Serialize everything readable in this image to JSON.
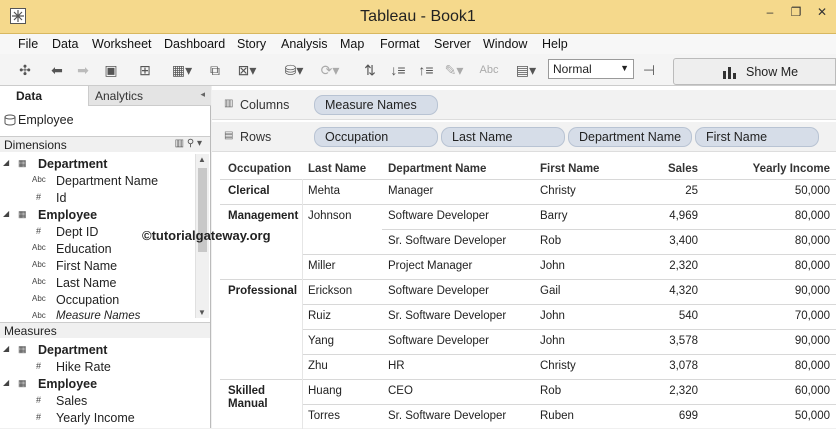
{
  "window": {
    "title": "Tableau - Book1",
    "min": "‒",
    "max": "❐",
    "close": "✕"
  },
  "menu": [
    "File",
    "Data",
    "Worksheet",
    "Dashboard",
    "Story",
    "Analysis",
    "Map",
    "Format",
    "Server",
    "Window",
    "Help"
  ],
  "toolbar": {
    "fit_value": "Normal",
    "show_me": "Show Me",
    "ghost_text": "Abc"
  },
  "left_pane": {
    "tab_data": "Data",
    "tab_analytics": "Analytics",
    "datasource": "Employee",
    "dimensions_label": "Dimensions",
    "measures_label": "Measures",
    "dimensions": [
      {
        "type": "table",
        "label": "Department"
      },
      {
        "type": "Abc",
        "label": "Department Name"
      },
      {
        "type": "#",
        "label": "Id"
      },
      {
        "type": "table",
        "label": "Employee"
      },
      {
        "type": "#",
        "label": "Dept ID"
      },
      {
        "type": "Abc",
        "label": "Education"
      },
      {
        "type": "Abc",
        "label": "First Name"
      },
      {
        "type": "Abc",
        "label": "Last Name"
      },
      {
        "type": "Abc",
        "label": "Occupation"
      },
      {
        "type": "Abc",
        "label": "Measure Names"
      }
    ],
    "measures": [
      {
        "type": "table",
        "label": "Department"
      },
      {
        "type": "#",
        "label": "Hike Rate"
      },
      {
        "type": "table",
        "label": "Employee"
      },
      {
        "type": "#",
        "label": "Sales"
      },
      {
        "type": "#",
        "label": "Yearly Income"
      }
    ]
  },
  "shelves": {
    "columns_label": "Columns",
    "rows_label": "Rows",
    "columns_pills": [
      "Measure Names"
    ],
    "rows_pills": [
      "Occupation",
      "Last Name",
      "Department Name",
      "First Name"
    ]
  },
  "watermark": "©tutorialgateway.org",
  "table": {
    "headers": [
      "Occupation",
      "Last Name",
      "Department Name",
      "First Name",
      "Sales",
      "Yearly Income"
    ],
    "rows": [
      [
        "Clerical",
        "Mehta",
        "Manager",
        "Christy",
        "25",
        "50,000"
      ],
      [
        "Management",
        "Johnson",
        "Software Developer",
        "Barry",
        "4,969",
        "80,000"
      ],
      [
        "",
        "",
        "Sr. Software Developer",
        "Rob",
        "3,400",
        "80,000"
      ],
      [
        "",
        "Miller",
        "Project Manager",
        "John",
        "2,320",
        "80,000"
      ],
      [
        "Professional",
        "Erickson",
        "Software Developer",
        "Gail",
        "4,320",
        "90,000"
      ],
      [
        "",
        "Ruiz",
        "Sr. Software Developer",
        "John",
        "540",
        "70,000"
      ],
      [
        "",
        "Yang",
        "Software Developer",
        "John",
        "3,578",
        "90,000"
      ],
      [
        "",
        "Zhu",
        "HR",
        "Christy",
        "3,078",
        "80,000"
      ],
      [
        "Skilled\nManual",
        "Huang",
        "CEO",
        "Rob",
        "2,320",
        "60,000"
      ],
      [
        "",
        "Torres",
        "Sr. Software Developer",
        "Ruben",
        "699",
        "50,000"
      ]
    ]
  }
}
